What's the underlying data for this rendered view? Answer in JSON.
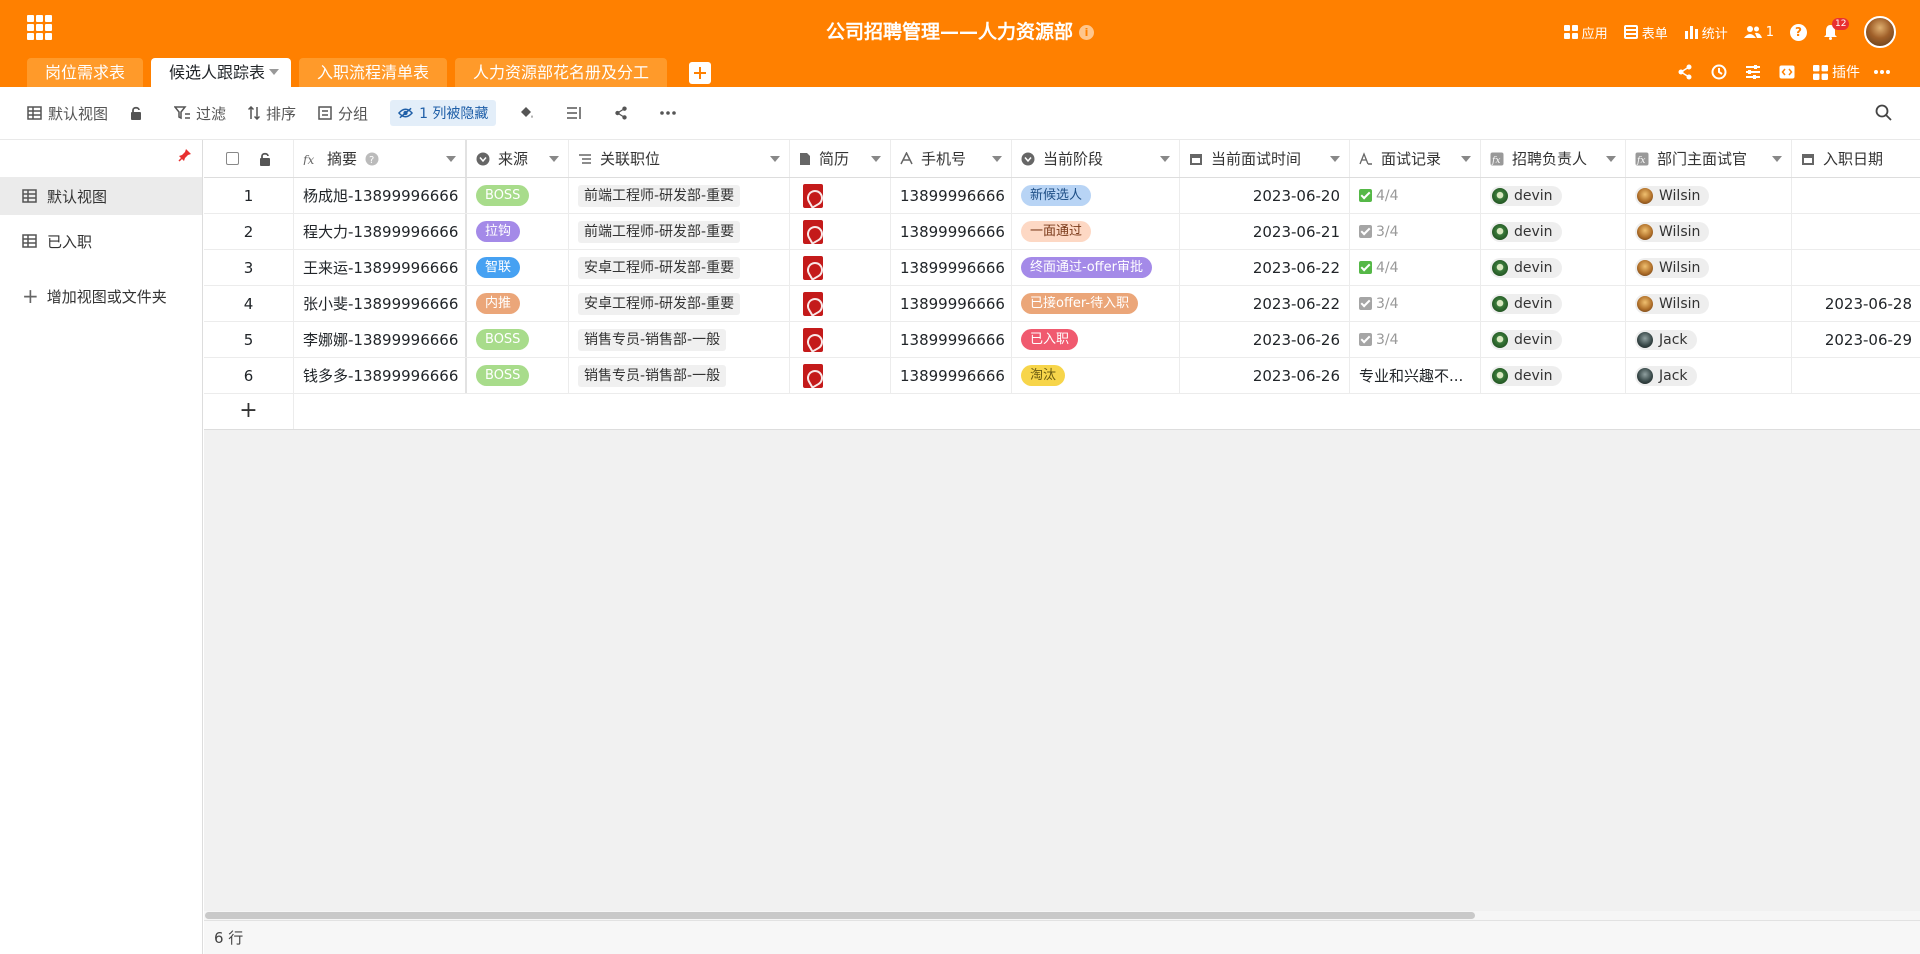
{
  "header": {
    "title": "公司招聘管理——人力资源部",
    "actions": {
      "apps": "应用",
      "forms": "表单",
      "stats": "统计",
      "collab_count": "1",
      "notif_count": "12"
    }
  },
  "tabs": [
    "岗位需求表",
    "候选人跟踪表",
    "入职流程清单表",
    "人力资源部花名册及分工"
  ],
  "tab_tools": {
    "plugins": "插件"
  },
  "toolbar": {
    "view": "默认视图",
    "filter": "过滤",
    "sort": "排序",
    "group": "分组",
    "hidden": "1 列被隐藏"
  },
  "sidebar": {
    "views": [
      "默认视图",
      "已入职"
    ],
    "add_view": "增加视图或文件夹"
  },
  "columns": {
    "summary": "摘要",
    "source": "来源",
    "job": "关联职位",
    "cv": "简历",
    "phone": "手机号",
    "stage": "当前阶段",
    "time": "当前面试时间",
    "record": "面试记录",
    "hr": "招聘负责人",
    "mgr": "部门主面试官",
    "date": "入职日期"
  },
  "rows": [
    {
      "idx": "1",
      "summary": "杨成旭-13899996666",
      "source": "BOSS",
      "source_color": "#a8dc8b",
      "job": "前端工程师-研发部-重要",
      "phone": "13899996666",
      "stage": "新候选人",
      "stage_bg": "#b8d4f5",
      "stage_fg": "#1f4f86",
      "time": "2023-06-20",
      "record": "4/4",
      "record_color": "#55b847",
      "hr": "devin",
      "mgr": "Wilsin",
      "mgr_av": "wilsin",
      "date": ""
    },
    {
      "idx": "2",
      "summary": "程大力-13899996666",
      "source": "拉钩",
      "source_color": "#a48ae8",
      "job": "前端工程师-研发部-重要",
      "phone": "13899996666",
      "stage": "一面通过",
      "stage_bg": "#fdd8c4",
      "stage_fg": "#7a3a1a",
      "time": "2023-06-21",
      "record": "3/4",
      "record_color": "#a5a5a5",
      "hr": "devin",
      "mgr": "Wilsin",
      "mgr_av": "wilsin",
      "date": ""
    },
    {
      "idx": "3",
      "summary": "王来运-13899996666",
      "source": "智联",
      "source_color": "#46a1f2",
      "job": "安卓工程师-研发部-重要",
      "phone": "13899996666",
      "stage": "终面通过-offer审批",
      "stage_bg": "#a48ae8",
      "stage_fg": "#ffffff",
      "time": "2023-06-22",
      "record": "4/4",
      "record_color": "#55b847",
      "hr": "devin",
      "mgr": "Wilsin",
      "mgr_av": "wilsin",
      "date": ""
    },
    {
      "idx": "4",
      "summary": "张小斐-13899996666",
      "source": "内推",
      "source_color": "#eba679",
      "job": "安卓工程师-研发部-重要",
      "phone": "13899996666",
      "stage": "已接offer-待入职",
      "stage_bg": "#eba679",
      "stage_fg": "#ffffff",
      "time": "2023-06-22",
      "record": "3/4",
      "record_color": "#a5a5a5",
      "hr": "devin",
      "mgr": "Wilsin",
      "mgr_av": "wilsin",
      "date": "2023-06-28"
    },
    {
      "idx": "5",
      "summary": "李娜娜-13899996666",
      "source": "BOSS",
      "source_color": "#a8dc8b",
      "job": "销售专员-销售部-一般",
      "phone": "13899996666",
      "stage": "已入职",
      "stage_bg": "#f05a6f",
      "stage_fg": "#ffffff",
      "time": "2023-06-26",
      "record": "3/4",
      "record_color": "#a5a5a5",
      "hr": "devin",
      "mgr": "Jack",
      "mgr_av": "jack",
      "date": "2023-06-29"
    },
    {
      "idx": "6",
      "summary": "钱多多-13899996666",
      "source": "BOSS",
      "source_color": "#a8dc8b",
      "job": "销售专员-销售部-一般",
      "phone": "13899996666",
      "stage": "淘汰",
      "stage_bg": "#f7d54a",
      "stage_fg": "#6a5a10",
      "time": "2023-06-26",
      "record_text": "专业和兴趣不...",
      "hr": "devin",
      "mgr": "Jack",
      "mgr_av": "jack",
      "date": ""
    }
  ],
  "footer": {
    "row_count": "6 行"
  },
  "colors": {
    "brand": "#ff8000"
  }
}
